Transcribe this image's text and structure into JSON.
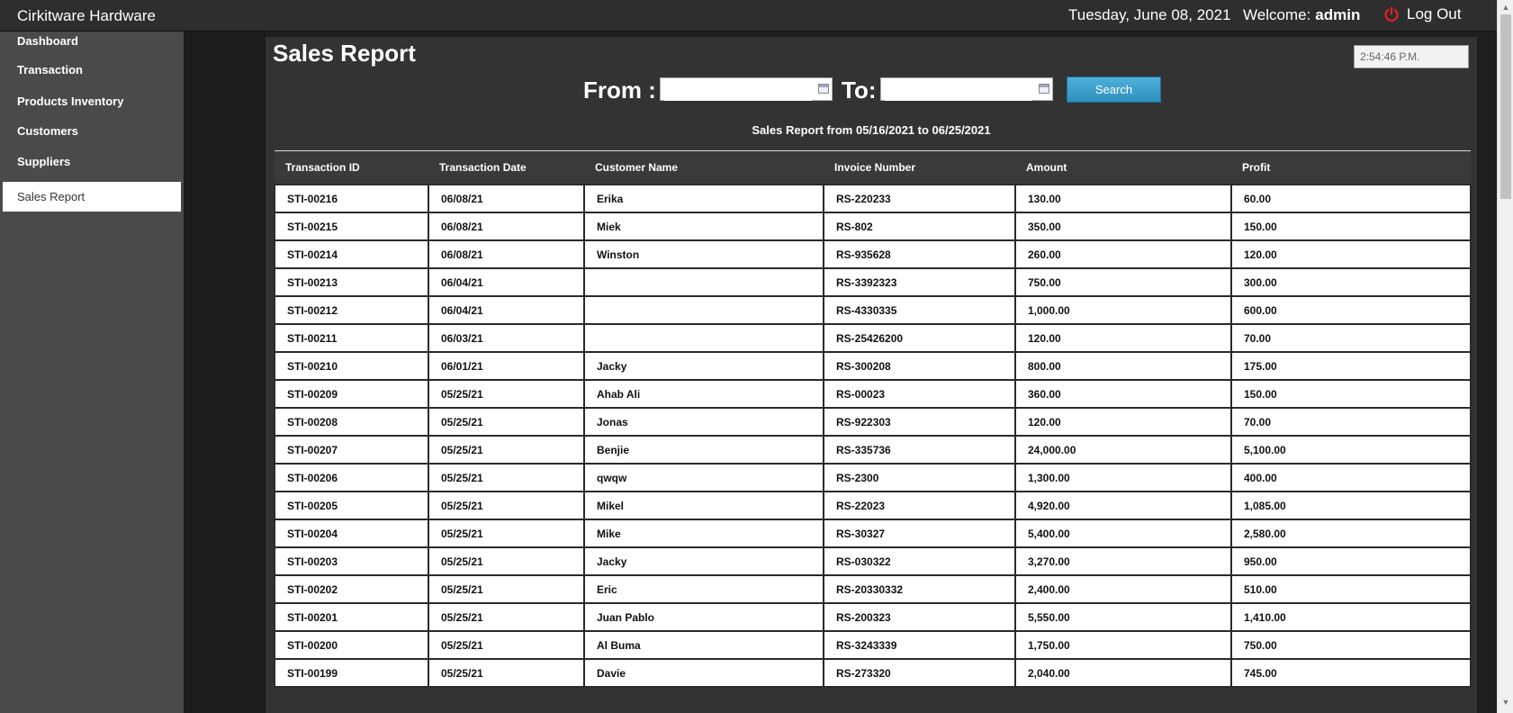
{
  "header": {
    "brand": "Cirkitware Hardware",
    "date": "Tuesday, June 08, 2021",
    "welcome_label": "Welcome:",
    "username": "admin",
    "logout_label": "Log Out",
    "logout_icon": "power-icon",
    "logout_icon_color": "#e02020"
  },
  "sidebar": {
    "items": [
      {
        "label": "Dashboard"
      },
      {
        "label": "Transaction"
      },
      {
        "label": "Products Inventory"
      },
      {
        "label": "Customers"
      },
      {
        "label": "Suppliers"
      },
      {
        "label": "Sales Report",
        "active": true
      }
    ]
  },
  "main": {
    "title": "Sales Report",
    "clock": "2:54:46 P.M.",
    "from_label": "From :",
    "to_label": "To:",
    "from_value": "",
    "to_value": "",
    "search_label": "Search",
    "search_color": "#3a9fd0",
    "caption": "Sales Report from 05/16/2021 to 06/25/2021"
  },
  "table": {
    "columns": [
      "Transaction ID",
      "Transaction Date",
      "Customer Name",
      "Invoice Number",
      "Amount",
      "Profit"
    ],
    "rows": [
      [
        "STI-00216",
        "06/08/21",
        "Erika",
        "RS-220233",
        "130.00",
        "60.00"
      ],
      [
        "STI-00215",
        "06/08/21",
        "Miek",
        "RS-802",
        "350.00",
        "150.00"
      ],
      [
        "STI-00214",
        "06/08/21",
        "Winston",
        "RS-935628",
        "260.00",
        "120.00"
      ],
      [
        "STI-00213",
        "06/04/21",
        "",
        "RS-3392323",
        "750.00",
        "300.00"
      ],
      [
        "STI-00212",
        "06/04/21",
        "",
        "RS-4330335",
        "1,000.00",
        "600.00"
      ],
      [
        "STI-00211",
        "06/03/21",
        "",
        "RS-25426200",
        "120.00",
        "70.00"
      ],
      [
        "STI-00210",
        "06/01/21",
        "Jacky",
        "RS-300208",
        "800.00",
        "175.00"
      ],
      [
        "STI-00209",
        "05/25/21",
        "Ahab Ali",
        "RS-00023",
        "360.00",
        "150.00"
      ],
      [
        "STI-00208",
        "05/25/21",
        "Jonas",
        "RS-922303",
        "120.00",
        "70.00"
      ],
      [
        "STI-00207",
        "05/25/21",
        "Benjie",
        "RS-335736",
        "24,000.00",
        "5,100.00"
      ],
      [
        "STI-00206",
        "05/25/21",
        "qwqw",
        "RS-2300",
        "1,300.00",
        "400.00"
      ],
      [
        "STI-00205",
        "05/25/21",
        "Mikel",
        "RS-22023",
        "4,920.00",
        "1,085.00"
      ],
      [
        "STI-00204",
        "05/25/21",
        "Mike",
        "RS-30327",
        "5,400.00",
        "2,580.00"
      ],
      [
        "STI-00203",
        "05/25/21",
        "Jacky",
        "RS-030322",
        "3,270.00",
        "950.00"
      ],
      [
        "STI-00202",
        "05/25/21",
        "Eric",
        "RS-20330332",
        "2,400.00",
        "510.00"
      ],
      [
        "STI-00201",
        "05/25/21",
        "Juan Pablo",
        "RS-200323",
        "5,550.00",
        "1,410.00"
      ],
      [
        "STI-00200",
        "05/25/21",
        "Al Buma",
        "RS-3243339",
        "1,750.00",
        "750.00"
      ],
      [
        "STI-00199",
        "05/25/21",
        "Davie",
        "RS-273320",
        "2,040.00",
        "745.00"
      ]
    ]
  }
}
